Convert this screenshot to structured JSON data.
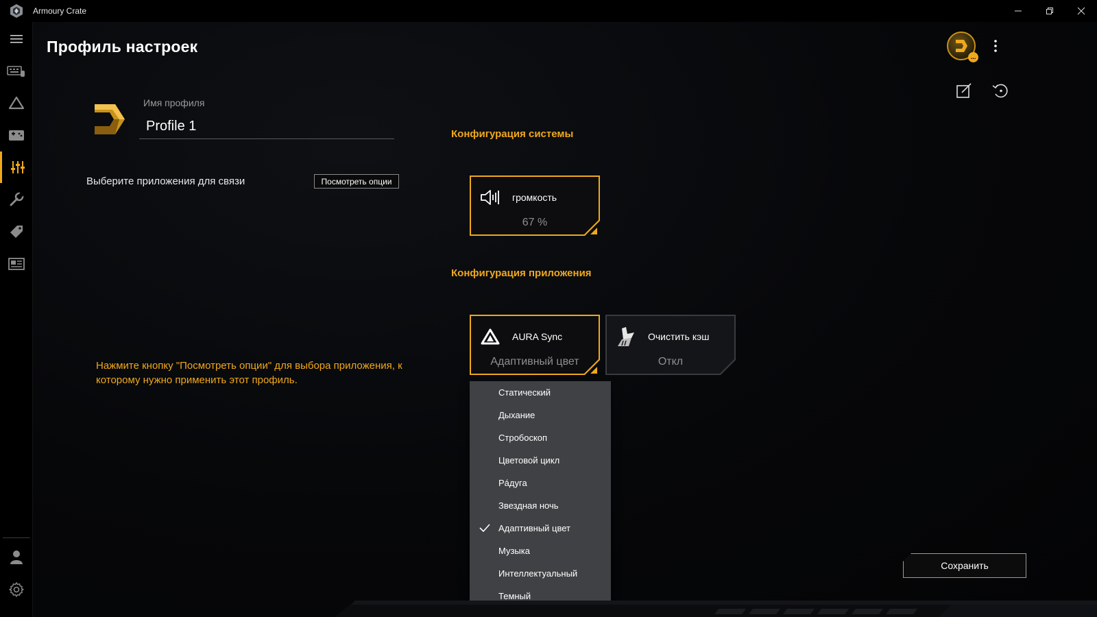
{
  "window": {
    "title": "Armoury Crate",
    "controls": [
      "minimize",
      "restore",
      "close"
    ]
  },
  "sidebar": {
    "items": [
      {
        "icon": "menu-icon"
      },
      {
        "icon": "device-icon"
      },
      {
        "icon": "aura-icon"
      },
      {
        "icon": "gamevisual-icon"
      },
      {
        "icon": "scenario-profile-icon",
        "active": true
      },
      {
        "icon": "tools-icon"
      },
      {
        "icon": "deals-icon"
      },
      {
        "icon": "news-icon"
      }
    ],
    "bottom": [
      {
        "icon": "user-icon"
      },
      {
        "icon": "settings-icon"
      }
    ]
  },
  "page": {
    "title": "Профиль настроек"
  },
  "profile": {
    "name_label": "Имя профиля",
    "name_value": "Profile 1",
    "link_label": "Выберите приложения для связи",
    "view_options_button": "Посмотреть опции",
    "hint": "Нажмите кнопку \"Посмотреть опции\" для выбора приложения, к которому нужно применить этот профиль."
  },
  "system_config": {
    "title": "Конфигурация системы",
    "cards": [
      {
        "label": "громкость",
        "value": "67 %",
        "icon": "volume-icon",
        "selected": true
      }
    ]
  },
  "app_config": {
    "title": "Конфигурация приложения",
    "cards": [
      {
        "label": "AURA Sync",
        "value": "Адаптивный цвет",
        "icon": "aura-sync-icon",
        "selected": true
      },
      {
        "label": "Очистить кэш",
        "value": "Откл",
        "icon": "clear-cache-icon",
        "selected": false
      }
    ]
  },
  "dropdown": {
    "items": [
      "Статический",
      "Дыхание",
      "Стробоскоп",
      "Цветовой цикл",
      "Рáдуга",
      "Звездная ночь",
      "Адаптивный цвет",
      "Музыка",
      "Интеллектуальный",
      "Темный"
    ],
    "selected": "Адаптивный цвет"
  },
  "actions": {
    "save": "Сохранить"
  },
  "avatar": {
    "badge": "..."
  },
  "colors": {
    "accent": "#f0a81c",
    "background": "#060709",
    "dropdown": "#404144"
  }
}
